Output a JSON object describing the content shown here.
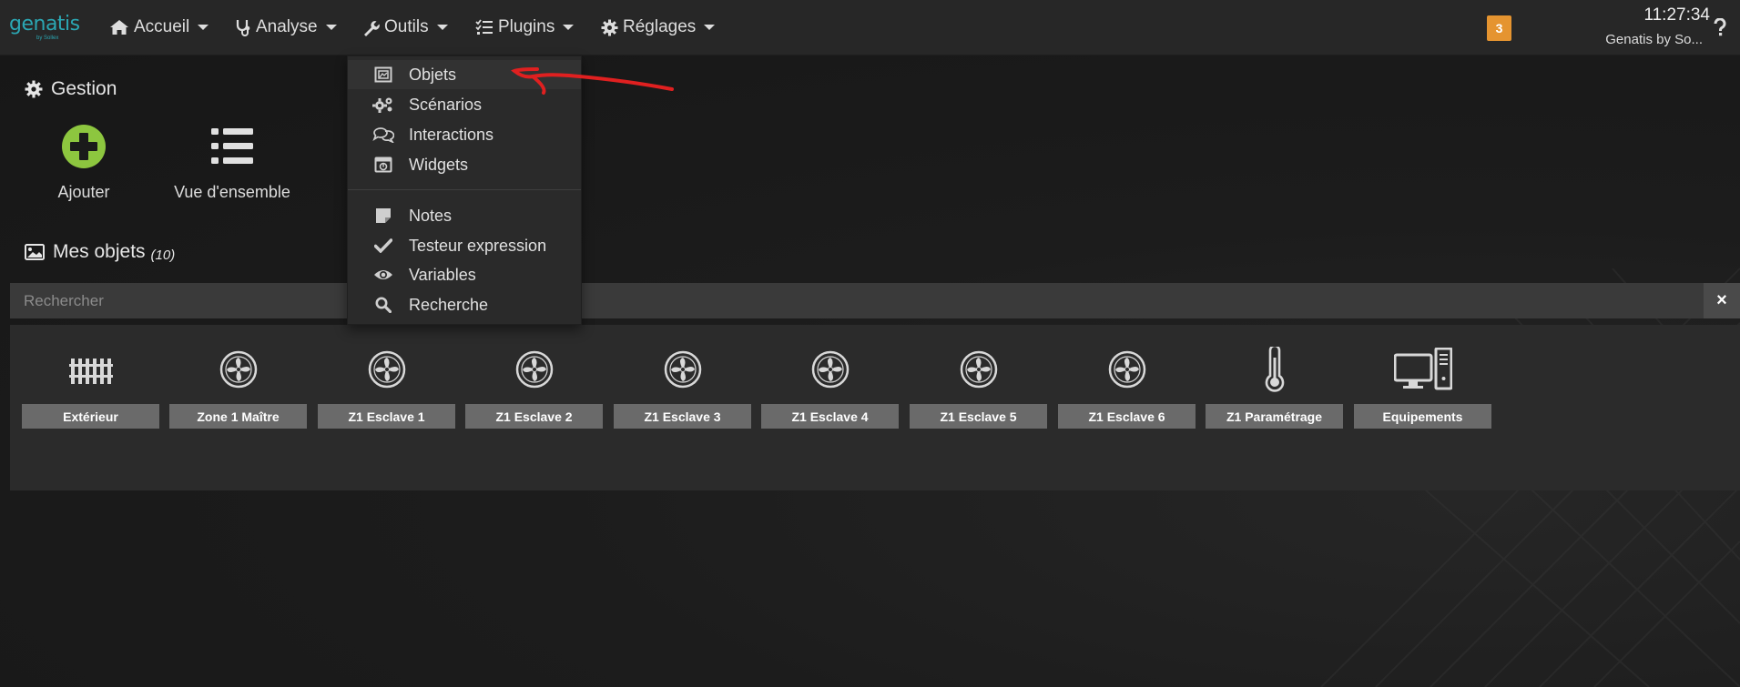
{
  "brand": {
    "name": "genatis",
    "tagline": "by Sollex"
  },
  "nav": {
    "accueil": "Accueil",
    "analyse": "Analyse",
    "outils": "Outils",
    "plugins": "Plugins",
    "reglages": "Réglages"
  },
  "header": {
    "badge_count": "3",
    "time": "11:27:34",
    "user": "Genatis by So..."
  },
  "tools_menu": {
    "items": [
      {
        "label": "Objets",
        "icon": "objects-icon"
      },
      {
        "label": "Scénarios",
        "icon": "cogs-icon"
      },
      {
        "label": "Interactions",
        "icon": "comments-icon"
      },
      {
        "label": "Widgets",
        "icon": "widget-icon"
      },
      {
        "label": "Notes",
        "icon": "note-icon"
      },
      {
        "label": "Testeur expression",
        "icon": "check-icon"
      },
      {
        "label": "Variables",
        "icon": "eye-icon"
      },
      {
        "label": "Recherche",
        "icon": "search-icon"
      }
    ]
  },
  "gestion": {
    "title": "Gestion",
    "add_label": "Ajouter",
    "overview_label": "Vue d'ensemble"
  },
  "objects": {
    "title": "Mes objets",
    "count": "(10)",
    "search_placeholder": "Rechercher",
    "clear_label": "×",
    "items": [
      {
        "label": "Extérieur",
        "icon": "fence-icon"
      },
      {
        "label": "Zone 1 Maître",
        "icon": "fan-icon"
      },
      {
        "label": "Z1 Esclave 1",
        "icon": "fan-icon"
      },
      {
        "label": "Z1 Esclave 2",
        "icon": "fan-icon"
      },
      {
        "label": "Z1 Esclave 3",
        "icon": "fan-icon"
      },
      {
        "label": "Z1 Esclave 4",
        "icon": "fan-icon"
      },
      {
        "label": "Z1 Esclave 5",
        "icon": "fan-icon"
      },
      {
        "label": "Z1 Esclave 6",
        "icon": "fan-icon"
      },
      {
        "label": "Z1 Paramétrage",
        "icon": "thermometer-icon"
      },
      {
        "label": "Equipements",
        "icon": "computer-icon"
      }
    ]
  },
  "colors": {
    "navbar": "#272727",
    "background": "#1a1a1a",
    "accent_green": "#8dc63f",
    "badge_orange": "#e59430",
    "brand_teal": "#2ba7b3",
    "annotation_red": "#e02020"
  }
}
